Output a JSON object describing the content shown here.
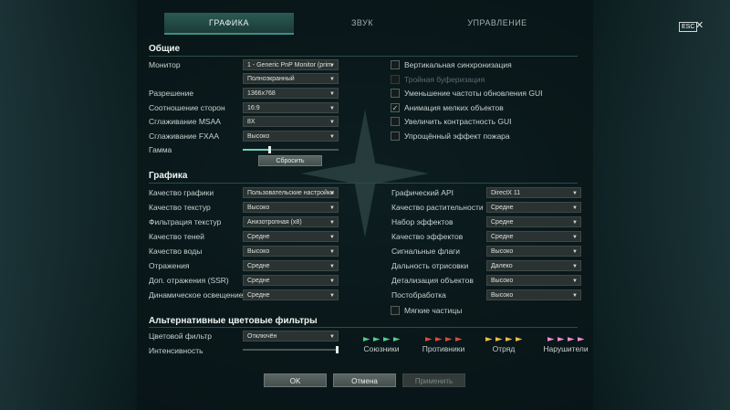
{
  "tabs": [
    {
      "label": "ГРАФИКА",
      "active": true
    },
    {
      "label": "ЗВУК",
      "active": false
    },
    {
      "label": "УПРАВЛЕНИЕ",
      "active": false
    }
  ],
  "esc_label": "ESC",
  "close_glyph": "✕",
  "general": {
    "title": "Общие",
    "monitor_label": "Монитор",
    "monitor_value": "1 - Generic PnP Monitor (prim",
    "mode_value": "Полноэкранный",
    "resolution_label": "Разрешение",
    "resolution_value": "1366x768",
    "aspect_label": "Соотношение сторон",
    "aspect_value": "16:9",
    "msaa_label": "Сглаживание MSAA",
    "msaa_value": "8X",
    "fxaa_label": "Сглаживание FXAA",
    "fxaa_value": "Высоко",
    "gamma_label": "Гамма",
    "gamma_level": 0.28,
    "reset_label": "Сбросить",
    "checkboxes": [
      {
        "label": "Вертикальная синхронизация",
        "checked": false,
        "enabled": true
      },
      {
        "label": "Тройная буферизация",
        "checked": false,
        "enabled": false
      },
      {
        "label": "Уменьшение частоты обновления GUI",
        "checked": false,
        "enabled": true
      },
      {
        "label": "Анимация мелких объектов",
        "checked": true,
        "enabled": true
      },
      {
        "label": "Увеличить контрастность GUI",
        "checked": false,
        "enabled": true
      },
      {
        "label": "Упрощённый эффект пожара",
        "checked": false,
        "enabled": true
      }
    ]
  },
  "graphics": {
    "title": "Графика",
    "left": [
      {
        "label": "Качество графики",
        "value": "Пользовательские настройки"
      },
      {
        "label": "Качество текстур",
        "value": "Высоко"
      },
      {
        "label": "Фильтрация текстур",
        "value": "Анизотропная (x8)"
      },
      {
        "label": "Качество теней",
        "value": "Средне"
      },
      {
        "label": "Качество воды",
        "value": "Высоко"
      },
      {
        "label": "Отражения",
        "value": "Средне"
      },
      {
        "label": "Доп. отражения (SSR)",
        "value": "Средне"
      },
      {
        "label": "Динамическое освещение",
        "value": "Средне"
      }
    ],
    "right": [
      {
        "label": "Графический API",
        "value": "DirectX 11"
      },
      {
        "label": "Качество растительности",
        "value": "Средне"
      },
      {
        "label": "Набор эффектов",
        "value": "Средне"
      },
      {
        "label": "Качество эффектов",
        "value": "Средне"
      },
      {
        "label": "Сигнальные флаги",
        "value": "Высоко"
      },
      {
        "label": "Дальность отрисовки",
        "value": "Далеко"
      },
      {
        "label": "Детализация объектов",
        "value": "Высоко"
      },
      {
        "label": "Постобработка",
        "value": "Высоко"
      }
    ],
    "soft_particles_label": "Мягкие частицы",
    "soft_particles_checked": false
  },
  "filters": {
    "title": "Альтернативные цветовые фильтры",
    "filter_label": "Цветовой фильтр",
    "filter_value": "Отключён",
    "intensity_label": "Интенсивность",
    "intensity_level": 1.0,
    "legend": [
      {
        "label": "Союзники",
        "color": "#4fd08a"
      },
      {
        "label": "Противники",
        "color": "#e04a3c"
      },
      {
        "label": "Отряд",
        "color": "#f0c040"
      },
      {
        "label": "Нарушители",
        "color": "#f08ad0"
      }
    ]
  },
  "buttons": {
    "ok": "OK",
    "cancel": "Отмена",
    "apply": "Применить"
  },
  "colors": {
    "accent": "#3f8f83",
    "slider_fill": "#6fd0c0"
  }
}
